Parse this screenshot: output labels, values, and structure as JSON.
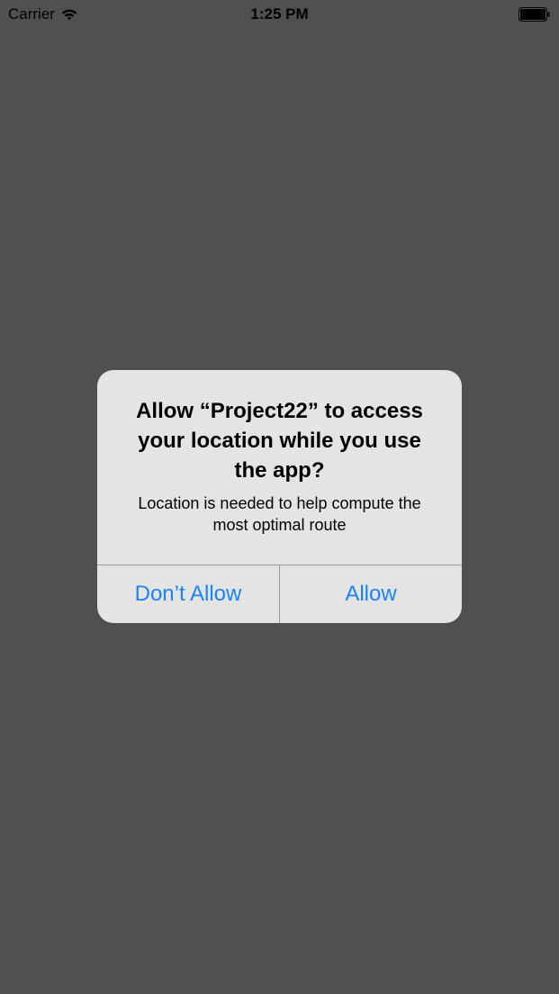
{
  "status_bar": {
    "carrier": "Carrier",
    "time": "1:25 PM",
    "wifi_icon": "wifi-icon",
    "battery_icon": "battery-icon"
  },
  "alert": {
    "title": "Allow “Project22” to access your location while you use the app?",
    "message": "Location is needed to help compute the most optimal route",
    "buttons": {
      "dont_allow": "Don’t Allow",
      "allow": "Allow"
    }
  },
  "colors": {
    "background": "#505050",
    "alert_background": "#e4e4e4",
    "button_text": "#1a82fb",
    "divider": "#9a9a9a"
  }
}
